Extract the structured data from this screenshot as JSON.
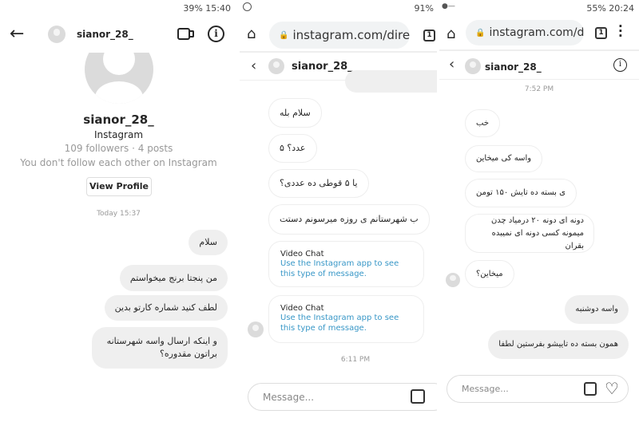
{
  "panel1": {
    "status": "39%  15:40",
    "header_username": "sianor_28_",
    "profile": {
      "username": "sianor_28_",
      "platform": "Instagram",
      "stats": "109 followers · 4 posts",
      "follow_status": "You don't follow each other on Instagram",
      "view_profile_label": "View Profile"
    },
    "timestamp": "Today 15:37",
    "messages": [
      {
        "dir": "out",
        "text": "سلام"
      },
      {
        "dir": "out",
        "text": "من پنجتا برنج میخواستم"
      },
      {
        "dir": "out",
        "text": "لطف کنید شماره کارتو بدین"
      },
      {
        "dir": "out",
        "text": "و اینکه ارسال واسه شهرستانه براتون مقدوره؟"
      }
    ]
  },
  "panel2": {
    "status": "91%",
    "url": "instagram.com/direct/t/",
    "tab_count": "1",
    "header_username": "sianor_28_",
    "messages": [
      {
        "dir": "in",
        "text": "سلام بله"
      },
      {
        "dir": "in",
        "text": "عدد؟ ۵"
      },
      {
        "dir": "in",
        "text": "یا ۵ قوطی ده عددی؟"
      },
      {
        "dir": "in",
        "text": "ب شهرستانم ی روزه میرسونم دستت"
      }
    ],
    "video_chats": [
      {
        "title": "Video Chat",
        "body": "Use the Instagram app to see this type of message."
      },
      {
        "title": "Video Chat",
        "body": "Use the Instagram app to see this type of message."
      }
    ],
    "timestamp": "6:11 PM",
    "message_placeholder": "Message..."
  },
  "panel3": {
    "status": "55%  20:24",
    "url": "instagram.com/direct/t/",
    "tab_count": "1",
    "header_username": "sianor_28_",
    "timestamp": "7:52 PM",
    "messages": [
      {
        "dir": "in",
        "text": "خب"
      },
      {
        "dir": "in",
        "text": "واسه کی میخاین"
      },
      {
        "dir": "in",
        "text": "ی بسته ده تایش ۱۵۰ تومن"
      },
      {
        "dir": "in",
        "text": "دونه ای دونه ۲۰ درمیاد چدن میمونه کسی دونه ای نمیبده بقران"
      },
      {
        "dir": "in",
        "text": "میخاین؟"
      },
      {
        "dir": "out",
        "text": "واسه دوشنبه"
      },
      {
        "dir": "out",
        "text": "همون بسته ده تاییشو بفرستین لطفا"
      }
    ],
    "message_placeholder": "Message..."
  },
  "colors": {
    "link": "#3897c7",
    "bubble_out": "#efefef"
  }
}
